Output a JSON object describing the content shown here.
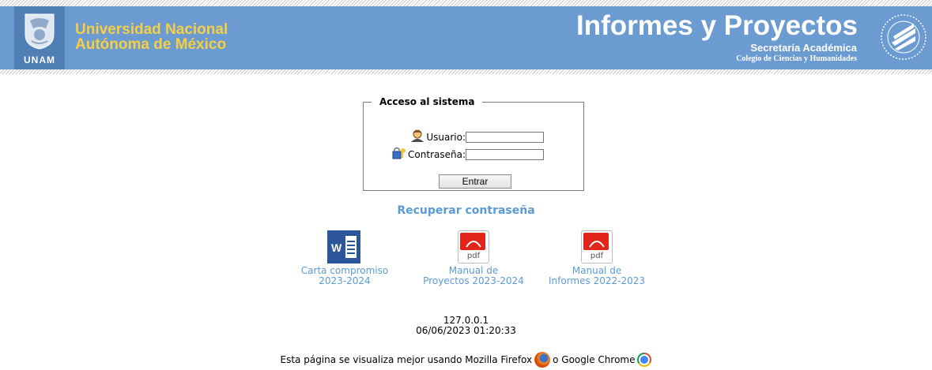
{
  "header": {
    "unam_label": "UNAM",
    "university_line1": "Universidad Nacional",
    "university_line2": "Autónoma de México",
    "app_title": "Informes y Proyectos",
    "secretaria": "Secretaría Académica",
    "colegio": "Colegio de Ciencias y Humanidades",
    "colors": {
      "bar": "#6b9bd0",
      "university_text": "#f6cf45",
      "link": "#5b9bd5"
    }
  },
  "login": {
    "legend": "Acceso al sistema",
    "user_label": "Usuario:",
    "user_value": "",
    "password_label": "Contraseña:",
    "password_value": "",
    "submit_label": "Entrar"
  },
  "recover_link": "Recuperar contraseña",
  "documents": [
    {
      "icon": "word-icon",
      "line1": "Carta compromiso",
      "line2": "2023-2024"
    },
    {
      "icon": "pdf-icon",
      "line1": "Manual de",
      "line2": "Proyectos 2023-2024"
    },
    {
      "icon": "pdf-icon",
      "line1": "Manual de",
      "line2": "Informes 2022-2023"
    }
  ],
  "pdf_icon_text": "pdf",
  "word_icon_text": "W",
  "server": {
    "ip": "127.0.0.1",
    "datetime": "06/06/2023 01:20:33"
  },
  "footer": {
    "text_before": "Esta página se visualiza mejor usando Mozilla Firefox",
    "text_middle": "o Google Chrome"
  }
}
